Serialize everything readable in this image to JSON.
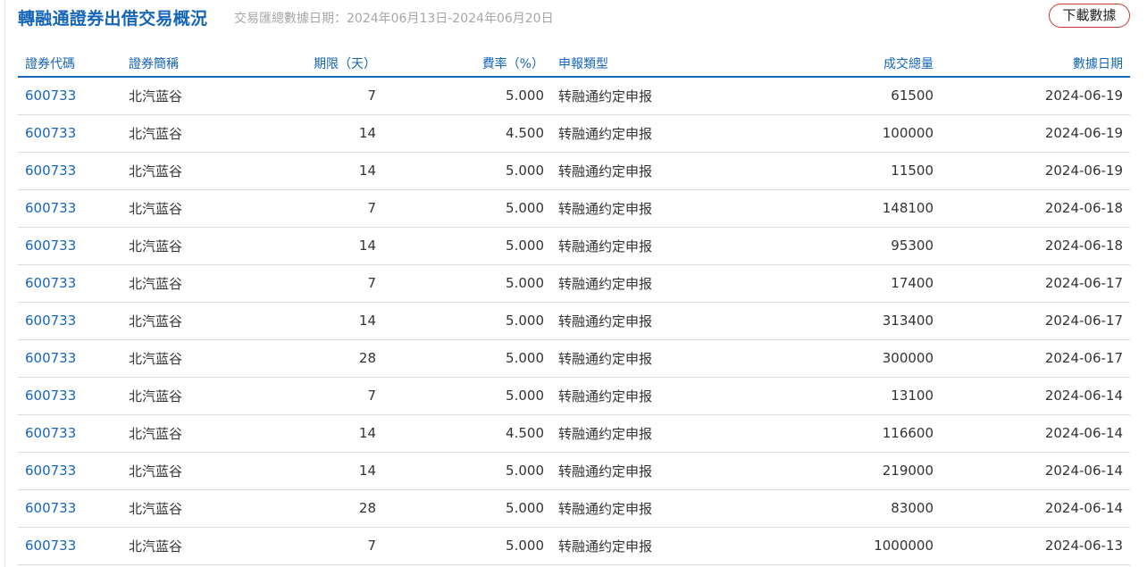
{
  "header": {
    "title": "轉融通證券出借交易概況",
    "subtitle": "交易匯總數據日期：2024年06月13日-2024年06月20日",
    "download_label": "下載數據",
    "accent_color": "#1565b8",
    "button_border_color": "#c0392b"
  },
  "table": {
    "columns": [
      "證券代碼",
      "證券簡稱",
      "期限（天）",
      "費率（%）",
      "申報類型",
      "成交總量",
      "數據日期"
    ],
    "rows": [
      [
        "600733",
        "北汽蓝谷",
        "7",
        "5.000",
        "转融通约定申报",
        "61500",
        "2024-06-19"
      ],
      [
        "600733",
        "北汽蓝谷",
        "14",
        "4.500",
        "转融通约定申报",
        "100000",
        "2024-06-19"
      ],
      [
        "600733",
        "北汽蓝谷",
        "14",
        "5.000",
        "转融通约定申报",
        "11500",
        "2024-06-19"
      ],
      [
        "600733",
        "北汽蓝谷",
        "7",
        "5.000",
        "转融通约定申报",
        "148100",
        "2024-06-18"
      ],
      [
        "600733",
        "北汽蓝谷",
        "14",
        "5.000",
        "转融通约定申报",
        "95300",
        "2024-06-18"
      ],
      [
        "600733",
        "北汽蓝谷",
        "7",
        "5.000",
        "转融通约定申报",
        "17400",
        "2024-06-17"
      ],
      [
        "600733",
        "北汽蓝谷",
        "14",
        "5.000",
        "转融通约定申报",
        "313400",
        "2024-06-17"
      ],
      [
        "600733",
        "北汽蓝谷",
        "28",
        "5.000",
        "转融通约定申报",
        "300000",
        "2024-06-17"
      ],
      [
        "600733",
        "北汽蓝谷",
        "7",
        "5.000",
        "转融通约定申报",
        "13100",
        "2024-06-14"
      ],
      [
        "600733",
        "北汽蓝谷",
        "14",
        "4.500",
        "转融通约定申报",
        "116600",
        "2024-06-14"
      ],
      [
        "600733",
        "北汽蓝谷",
        "14",
        "5.000",
        "转融通约定申报",
        "219000",
        "2024-06-14"
      ],
      [
        "600733",
        "北汽蓝谷",
        "28",
        "5.000",
        "转融通约定申报",
        "83000",
        "2024-06-14"
      ],
      [
        "600733",
        "北汽蓝谷",
        "7",
        "5.000",
        "转融通约定申报",
        "1000000",
        "2024-06-13"
      ]
    ]
  }
}
